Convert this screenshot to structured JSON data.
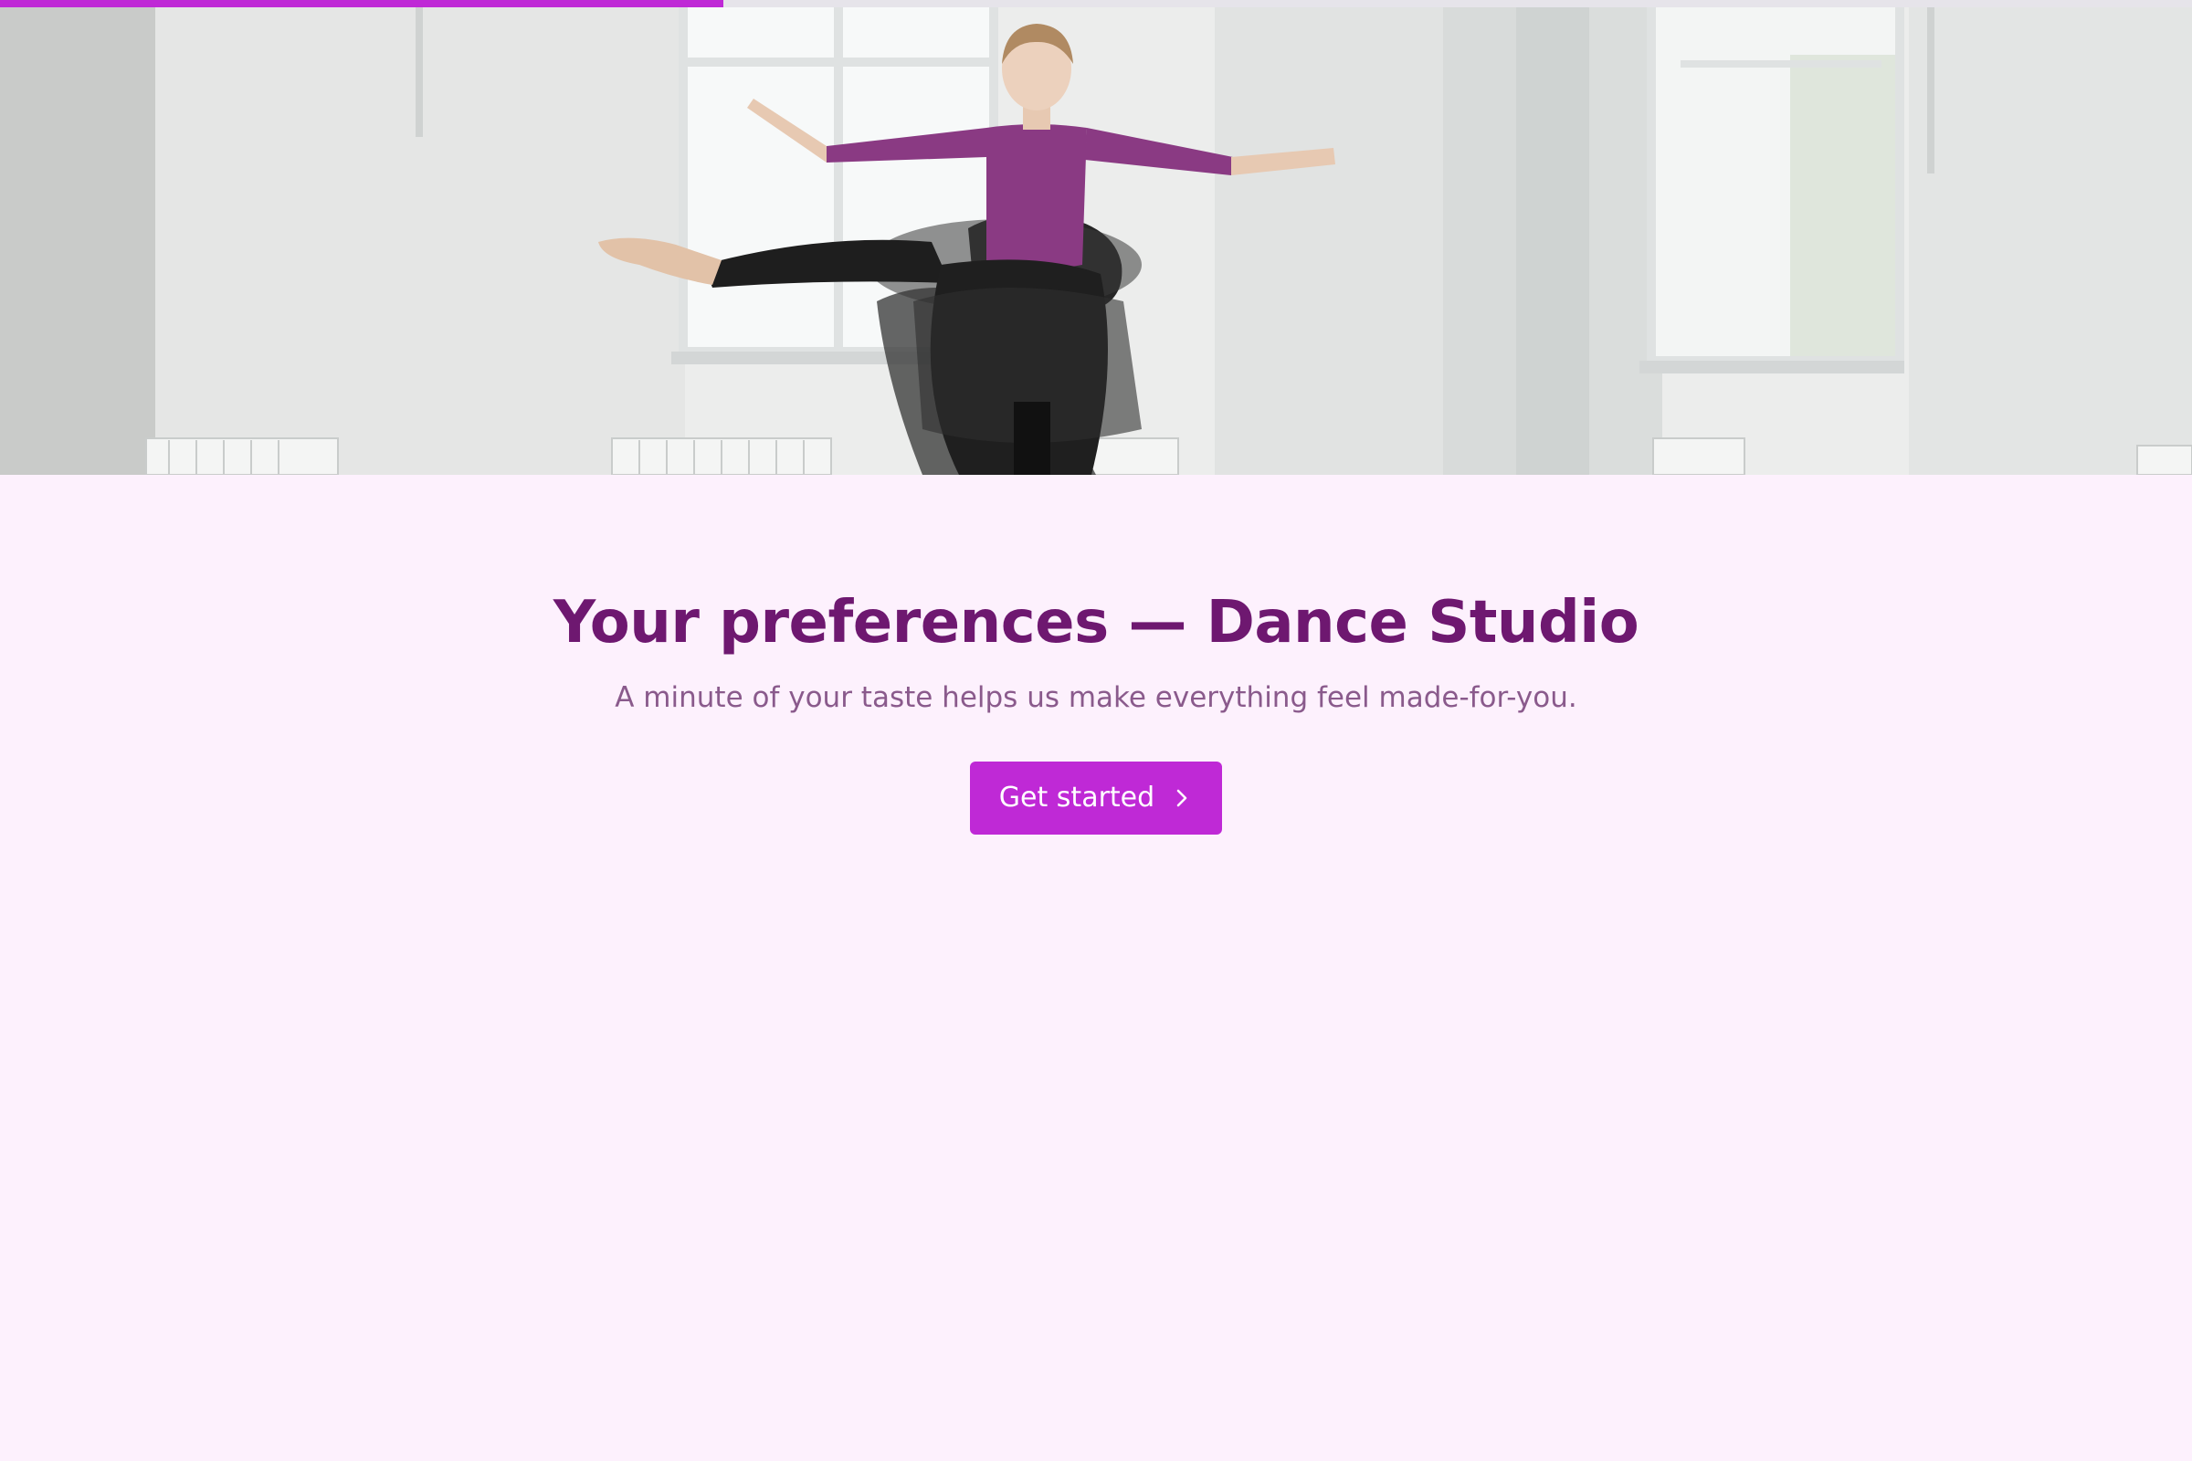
{
  "progress": {
    "value_fraction": 0.33,
    "track_color": "#e6e4ea",
    "fill_color": "#bf29d6"
  },
  "hero": {
    "image_subject": "two dancers in a bright white studio with large windows"
  },
  "content": {
    "title": "Your preferences — Dance Studio",
    "subtitle": "A minute of your taste helps us make everything feel made-for-you.",
    "cta_label": "Get started",
    "cta_icon": "chevron-right-icon"
  },
  "colors": {
    "background": "#fdf1fd",
    "title": "#6e1870",
    "subtitle": "#8a5a8c",
    "accent": "#bf29d6"
  }
}
